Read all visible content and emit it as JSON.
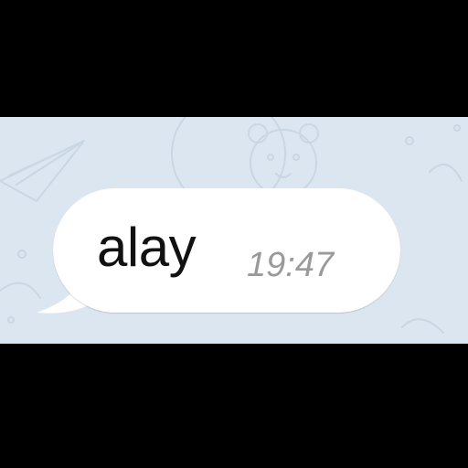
{
  "message": {
    "text": "alay",
    "time": "19:47"
  },
  "colors": {
    "chat_background": "#dce6f0",
    "bubble": "#ffffff",
    "message_text": "#111111",
    "time_text": "#9a9a9a",
    "letterbox": "#000000"
  }
}
